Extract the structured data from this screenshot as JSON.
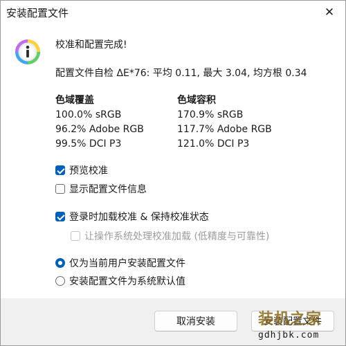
{
  "window": {
    "title": "安装配置文件",
    "close_glyph": "✕"
  },
  "message": {
    "icon": "info-icon",
    "headline": "校准和配置完成!",
    "stats": "配置文件自检 ΔE*76: 平均 0.11, 最大 3.04, 均方根 0.34"
  },
  "gamut": {
    "coverage": {
      "header": "色域覆盖",
      "rows": [
        "100.0% sRGB",
        "96.2% Adobe RGB",
        "99.5% DCI P3"
      ]
    },
    "volume": {
      "header": "色域容积",
      "rows": [
        "170.9% sRGB",
        "117.7% Adobe RGB",
        "121.0% DCI P3"
      ]
    }
  },
  "options": {
    "preview_calibration": {
      "label": "预览校准",
      "checked": true
    },
    "show_profile_info": {
      "label": "显示配置文件信息",
      "checked": false
    },
    "load_on_login": {
      "label": "登录时加载校准 & 保持校准状态",
      "checked": true
    },
    "os_handles_loading": {
      "label": "让操作系统处理校准加载 (低精度与可靠性)",
      "checked": false,
      "disabled": true
    }
  },
  "install_scope": {
    "current_user": {
      "label": "仅为当前用户安装配置文件",
      "selected": true
    },
    "system_default": {
      "label": "安装配置文件为系统默认值",
      "selected": false
    }
  },
  "buttons": {
    "cancel": "取消安装",
    "install": "安装配置文件"
  },
  "watermark": {
    "main": "装机之家",
    "sub": "gdhjbk.com"
  },
  "colors": {
    "accent": "#005fb8",
    "dialog_bg": "#f0f0f0",
    "content_bg": "#ffffff",
    "disabled_text": "#9c9c9c"
  }
}
